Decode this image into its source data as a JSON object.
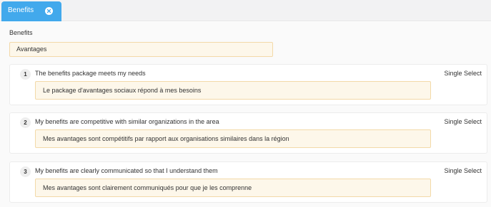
{
  "tab": {
    "label": "Benefits",
    "close_icon": "close-circle-icon",
    "accent_color": "#42a9ec"
  },
  "section": {
    "label": "Benefits",
    "translation_value": "Avantages"
  },
  "questions": [
    {
      "number": "1",
      "text": "The benefits package meets my needs",
      "type": "Single Select",
      "translation": "Le package d'avantages sociaux répond à mes besoins"
    },
    {
      "number": "2",
      "text": "My benefits are competitive with similar organizations in the area",
      "type": "Single Select",
      "translation": "Mes avantages sont compétitifs par rapport aux organisations similaires dans la région"
    },
    {
      "number": "3",
      "text": "My benefits are clearly communicated so that I understand them",
      "type": "Single Select",
      "translation": "Mes avantages sont clairement communiqués pour que je les comprenne"
    }
  ]
}
